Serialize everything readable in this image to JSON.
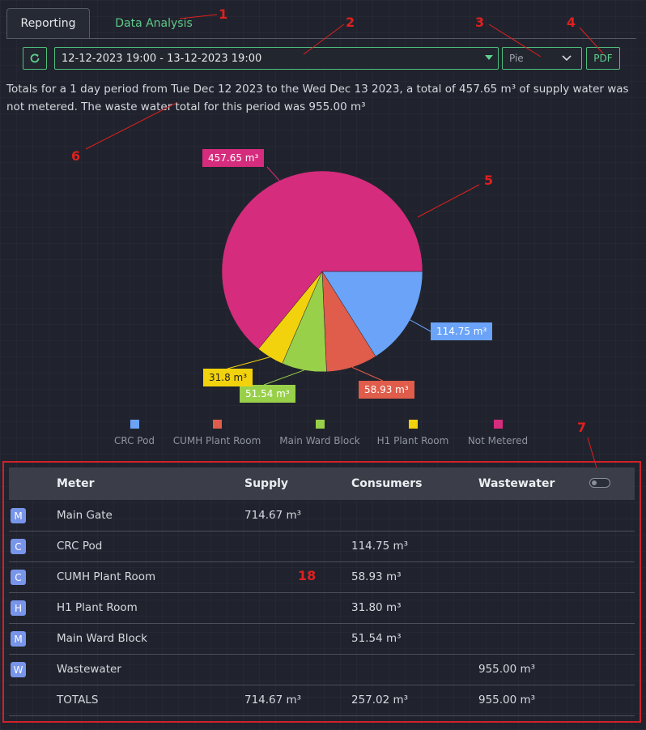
{
  "tabs": {
    "reporting": "Reporting",
    "analysis": "Data Analysis"
  },
  "controls": {
    "date_range": "12-12-2023 19:00 - 13-12-2023 19:00",
    "chart_type": "Pie",
    "pdf": "PDF"
  },
  "summary_text": "Totals for a 1 day period from Tue Dec 12 2023 to the Wed Dec 13 2023, a total of 457.65 m³ of supply water was not metered. The waste water total for this period was 955.00 m³",
  "annotations": [
    "1",
    "2",
    "3",
    "4",
    "5",
    "6",
    "7",
    "18"
  ],
  "colors": {
    "accent": "#4fbf7f",
    "highlight": "#d0212a"
  },
  "chart_data": {
    "type": "pie",
    "unit": "m³",
    "categories": [
      "CRC Pod",
      "CUMH Plant Room",
      "Main Ward Block",
      "H1 Plant Room",
      "Not Metered"
    ],
    "values": [
      114.75,
      58.93,
      51.54,
      31.8,
      457.65
    ],
    "data_labels": [
      "114.75  m³",
      "58.93  m³",
      "51.54  m³",
      "31.8  m³",
      "457.65  m³"
    ],
    "colors": [
      "#6aa3f8",
      "#e05c4b",
      "#98d04a",
      "#f2d20c",
      "#d62c7d"
    ],
    "legend_position": "bottom"
  },
  "table": {
    "headers": {
      "meter": "Meter",
      "supply": "Supply",
      "consumers": "Consumers",
      "wastewater": "Wastewater"
    },
    "rows": [
      {
        "badge": "M",
        "meter": "Main Gate",
        "supply": "714.67 m³",
        "consumers": "",
        "wastewater": ""
      },
      {
        "badge": "C",
        "meter": "CRC Pod",
        "supply": "",
        "consumers": "114.75 m³",
        "wastewater": ""
      },
      {
        "badge": "C",
        "meter": "CUMH Plant Room",
        "supply": "",
        "consumers": "58.93 m³",
        "wastewater": ""
      },
      {
        "badge": "H",
        "meter": "H1 Plant Room",
        "supply": "",
        "consumers": "31.80 m³",
        "wastewater": ""
      },
      {
        "badge": "M",
        "meter": "Main Ward Block",
        "supply": "",
        "consumers": "51.54 m³",
        "wastewater": ""
      },
      {
        "badge": "W",
        "meter": "Wastewater",
        "supply": "",
        "consumers": "",
        "wastewater": "955.00 m³"
      }
    ],
    "totals": {
      "label": "TOTALS",
      "supply": "714.67 m³",
      "consumers": "257.02 m³",
      "wastewater": "955.00 m³"
    }
  }
}
